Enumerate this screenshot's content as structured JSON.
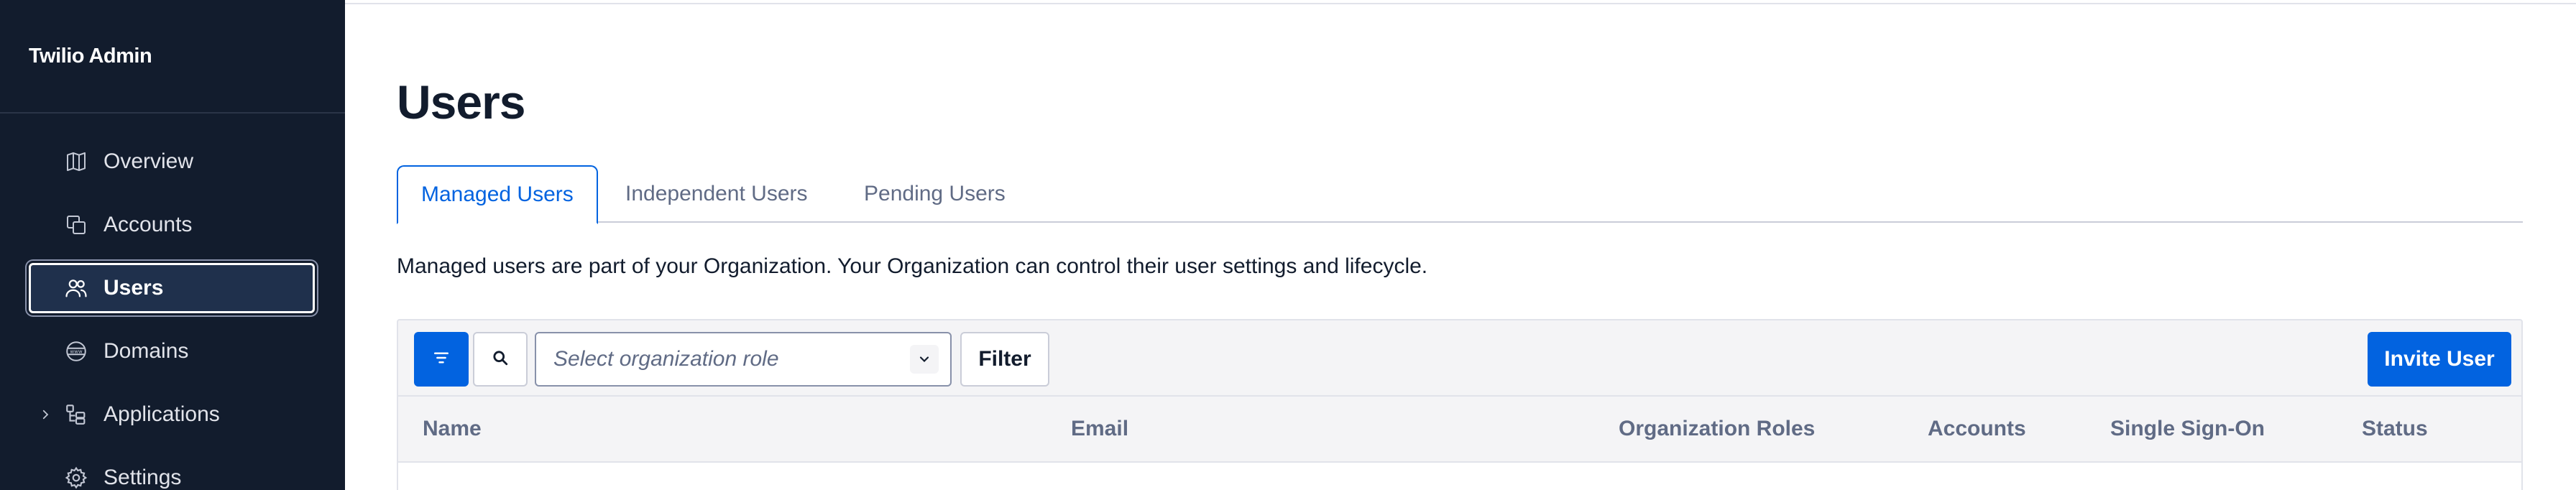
{
  "app": {
    "title": "Twilio Admin"
  },
  "sidebar": {
    "items": [
      {
        "label": "Overview",
        "icon": "map-icon"
      },
      {
        "label": "Accounts",
        "icon": "accounts-icon"
      },
      {
        "label": "Users",
        "icon": "users-icon",
        "active": true
      },
      {
        "label": "Domains",
        "icon": "globe-www-icon"
      },
      {
        "label": "Applications",
        "icon": "applications-icon",
        "expandable": true
      },
      {
        "label": "Settings",
        "icon": "gear-icon"
      }
    ]
  },
  "main": {
    "title": "Users",
    "tabs": [
      {
        "label": "Managed Users",
        "active": true
      },
      {
        "label": "Independent Users"
      },
      {
        "label": "Pending Users"
      }
    ],
    "description": "Managed users are part of your Organization. Your Organization can control their user settings and lifecycle.",
    "toolbar": {
      "role_select_placeholder": "Select organization role",
      "filter_label": "Filter",
      "invite_label": "Invite User"
    },
    "table": {
      "columns": [
        "Name",
        "Email",
        "Organization Roles",
        "Accounts",
        "Single Sign-On",
        "Status"
      ]
    }
  },
  "colors": {
    "sidebar_bg": "#121c2d",
    "accent": "#0263e0",
    "muted_text": "#606b85"
  }
}
